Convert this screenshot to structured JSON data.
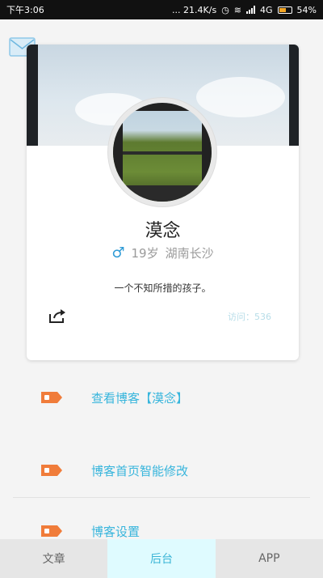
{
  "status_bar": {
    "time": "下午3:06",
    "speed": "... 21.4K/s",
    "network": "4G",
    "battery": "54%",
    "battery_level": 0.54
  },
  "profile": {
    "name": "漠念",
    "age": "19岁",
    "location": "湖南长沙",
    "bio": "一个不知所措的孩子。",
    "visits": "访问：536"
  },
  "menu": {
    "items": [
      {
        "label": "查看博客【漠念】"
      },
      {
        "label": "博客首页智能修改"
      },
      {
        "label": "博客设置"
      }
    ]
  },
  "bottom_nav": {
    "tabs": [
      {
        "label": "文章",
        "active": false
      },
      {
        "label": "后台",
        "active": true
      },
      {
        "label": "APP",
        "active": false
      }
    ]
  },
  "colors": {
    "accent": "#37b5dc",
    "tag": "#f07c3a",
    "active_tab_bg": "#dffbff"
  }
}
